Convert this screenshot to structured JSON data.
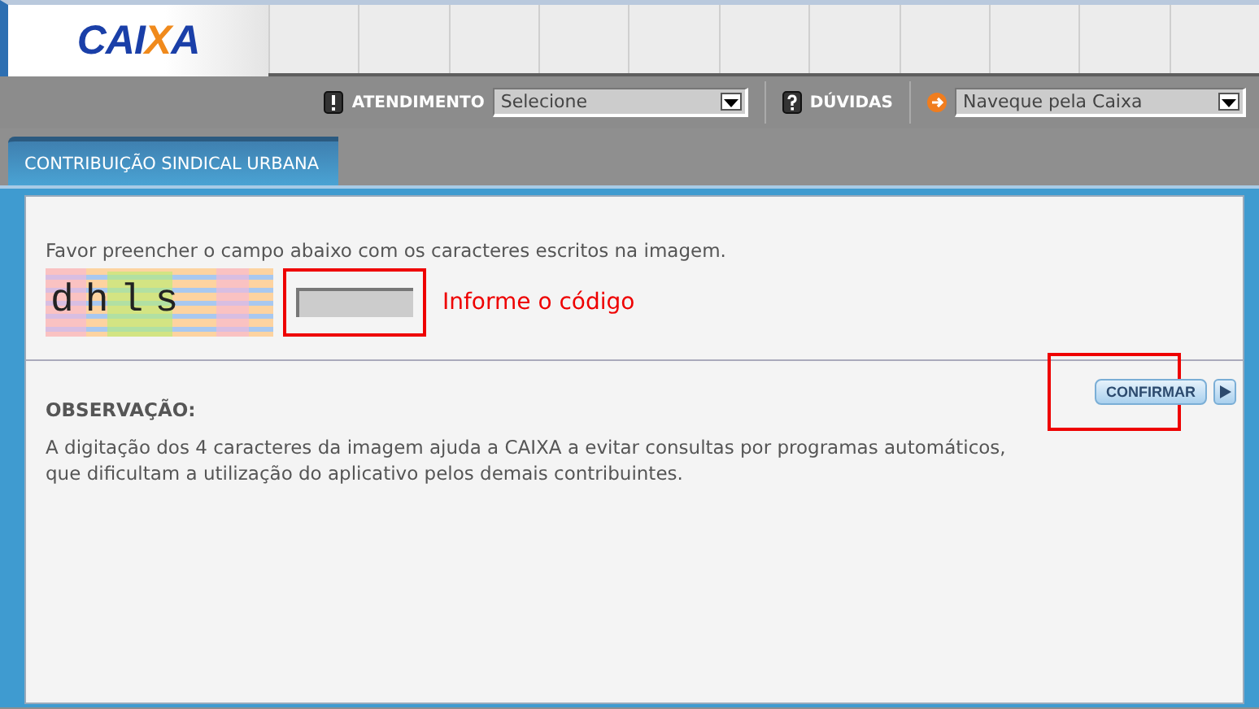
{
  "header": {
    "logo": "CAIXA"
  },
  "nav": [
    {
      "kind": "support",
      "label": "ATENDIMENTO",
      "value": "Selecione"
    },
    {
      "kind": "help",
      "label": "DÚVIDAS"
    },
    {
      "kind": "navigate",
      "value": "Naveque pela Caixa"
    }
  ],
  "tabs": [
    {
      "label": "CONTRIBUIÇÃO SINDICAL URBANA",
      "selected": true
    }
  ],
  "form": {
    "instruction": "Favor preencher o campo abaixo com os caracteres escritos na imagem.",
    "captcha": {
      "text": "dhls"
    },
    "code_field": {
      "highlighted": true
    },
    "hint": "Informe o código",
    "confirm_button": {
      "label": "CONFIRMAR",
      "highlighted": true
    }
  },
  "note": {
    "title": "OBSERVAÇÃO:",
    "text": "A digitação dos 4 caracteres da imagem ajuda a CAIXA a evitar consultas por programas automáticos, que dificultam a utilização do aplicativo pelos demais contribuintes."
  }
}
